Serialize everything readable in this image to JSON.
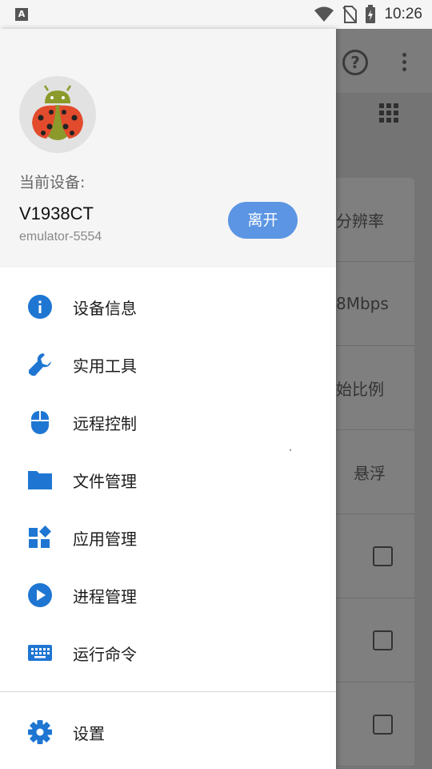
{
  "status_bar": {
    "time": "10:26",
    "notif_letter": "A"
  },
  "background": {
    "help_glyph": "?",
    "rows": [
      {
        "text": "分辨率"
      },
      {
        "text": "8Mbps"
      },
      {
        "text": "始比例"
      },
      {
        "text": "悬浮"
      }
    ],
    "checkbox_count": 3
  },
  "drawer": {
    "current_device_label": "当前设备:",
    "device_name": "V1938CT",
    "device_id": "emulator-5554",
    "leave_label": "离开",
    "menu": [
      {
        "label": "设备信息",
        "icon": "info-icon"
      },
      {
        "label": "实用工具",
        "icon": "wrench-icon"
      },
      {
        "label": "远程控制",
        "icon": "mouse-icon"
      },
      {
        "label": "文件管理",
        "icon": "folder-icon"
      },
      {
        "label": "应用管理",
        "icon": "apps-icon"
      },
      {
        "label": "进程管理",
        "icon": "play-icon"
      },
      {
        "label": "运行命令",
        "icon": "keyboard-icon"
      }
    ],
    "settings_label": "设置"
  },
  "colors": {
    "accent": "#1f76d2",
    "leave_button": "#5b95e3"
  }
}
